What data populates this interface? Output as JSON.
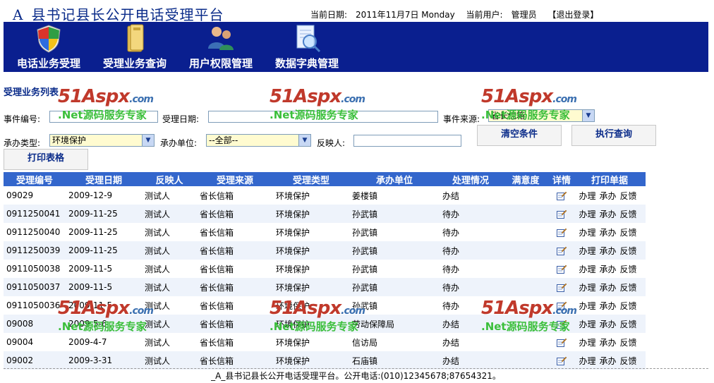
{
  "header": {
    "title": "_A_县书记县长公开电话受理平台",
    "date_label": "当前日期:",
    "date_value": "2011年11月7日 Monday",
    "user_label": "当前用户:",
    "user_value": "管理员",
    "logout": "【退出登录】"
  },
  "nav": [
    {
      "label": "电话业务受理",
      "icon": "shield-icon"
    },
    {
      "label": "受理业务查询",
      "icon": "folder-icon"
    },
    {
      "label": "用户权限管理",
      "icon": "users-icon"
    },
    {
      "label": "数据字典管理",
      "icon": "document-search-icon"
    }
  ],
  "section_title": "受理业务列表",
  "filters": {
    "event_no_label": "事件编号:",
    "event_no_value": "",
    "date_label": "受理日期:",
    "date_value": "",
    "source_label": "事件来源:",
    "source_value": "省长信箱",
    "type_label": "承办类型:",
    "type_value": "环境保护",
    "unit_label": "承办单位:",
    "unit_value": "--全部--",
    "reporter_label": "反映人:",
    "reporter_value": ""
  },
  "buttons": {
    "clear": "清空条件",
    "query": "执行查询",
    "print": "打印表格"
  },
  "watermark": {
    "logo": "51Aspx",
    "domain": ".com",
    "sub": ".Net源码服务专家"
  },
  "table": {
    "columns": [
      "受理编号",
      "受理日期",
      "反映人",
      "受理来源",
      "受理类型",
      "承办单位",
      "处理情况",
      "满意度",
      "详情",
      "打印单据"
    ],
    "print_links": [
      "办理",
      "承办",
      "反馈"
    ],
    "rows": [
      [
        "09029",
        "2009-12-9",
        "测试人",
        "省长信箱",
        "环境保护",
        "姜楼镇",
        "办结",
        ""
      ],
      [
        "0911250041",
        "2009-11-25",
        "测试人",
        "省长信箱",
        "环境保护",
        "孙武镇",
        "待办",
        ""
      ],
      [
        "0911250040",
        "2009-11-25",
        "测试人",
        "省长信箱",
        "环境保护",
        "孙武镇",
        "待办",
        ""
      ],
      [
        "0911250039",
        "2009-11-25",
        "测试人",
        "省长信箱",
        "环境保护",
        "孙武镇",
        "待办",
        ""
      ],
      [
        "0911050038",
        "2009-11-5",
        "测试人",
        "省长信箱",
        "环境保护",
        "孙武镇",
        "待办",
        ""
      ],
      [
        "0911050037",
        "2009-11-5",
        "测试人",
        "省长信箱",
        "环境保护",
        "孙武镇",
        "待办",
        ""
      ],
      [
        "0911050036",
        "2009-11-5",
        "测试人",
        "省长信箱",
        "环境保护",
        "孙武镇",
        "待办",
        ""
      ],
      [
        "09008",
        "2009-5-6",
        "测试人",
        "省长信箱",
        "环境保护",
        "劳动保障局",
        "办结",
        ""
      ],
      [
        "09004",
        "2009-4-7",
        "测试人",
        "省长信箱",
        "环境保护",
        "信访局",
        "办结",
        ""
      ],
      [
        "09002",
        "2009-3-31",
        "测试人",
        "省长信箱",
        "环境保护",
        "石庙镇",
        "办结",
        ""
      ]
    ]
  },
  "footer": "_A_县书记县长公开电话受理平台。公开电话:(010)12345678;87654321。"
}
